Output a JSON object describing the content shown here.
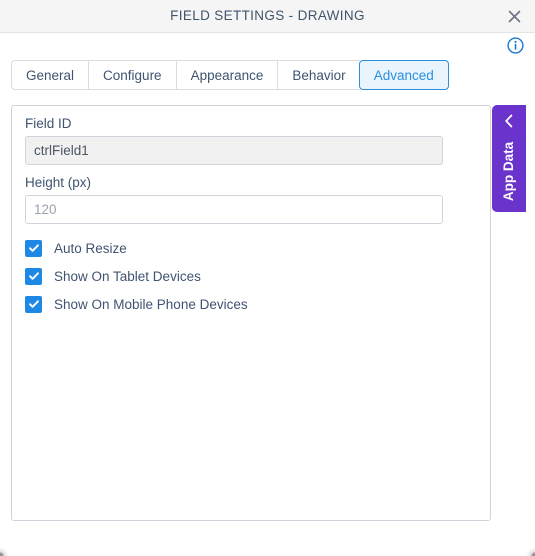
{
  "dialog": {
    "title": "FIELD SETTINGS - DRAWING",
    "close_label": "close-icon",
    "info_label": "info-icon"
  },
  "colors": {
    "titlebar_bg": "#F5F5F5",
    "title_text": "#40546B",
    "accent_blue": "#2B8FE0",
    "active_tab_bg": "#E9F4FD",
    "checkbox_blue": "#1E88E5",
    "app_data_purple": "#6A33CC",
    "panel_border": "#CFD4DC",
    "readonly_input_bg": "#F1F1F1"
  },
  "tabs": [
    {
      "label": "General",
      "active": false
    },
    {
      "label": "Configure",
      "active": false
    },
    {
      "label": "Appearance",
      "active": false
    },
    {
      "label": "Behavior",
      "active": false
    },
    {
      "label": "Advanced",
      "active": true
    }
  ],
  "form": {
    "field_id": {
      "label": "Field ID",
      "value": "ctrlField1",
      "placeholder": "",
      "readonly": true
    },
    "height": {
      "label": "Height (px)",
      "value": "",
      "placeholder": "120",
      "readonly": false
    }
  },
  "checkboxes": [
    {
      "label": "Auto Resize",
      "checked": true
    },
    {
      "label": "Show On Tablet Devices",
      "checked": true
    },
    {
      "label": "Show On Mobile Phone Devices",
      "checked": true
    }
  ],
  "app_data_panel": {
    "label": "App Data",
    "chevron": "chevron-left-icon"
  }
}
